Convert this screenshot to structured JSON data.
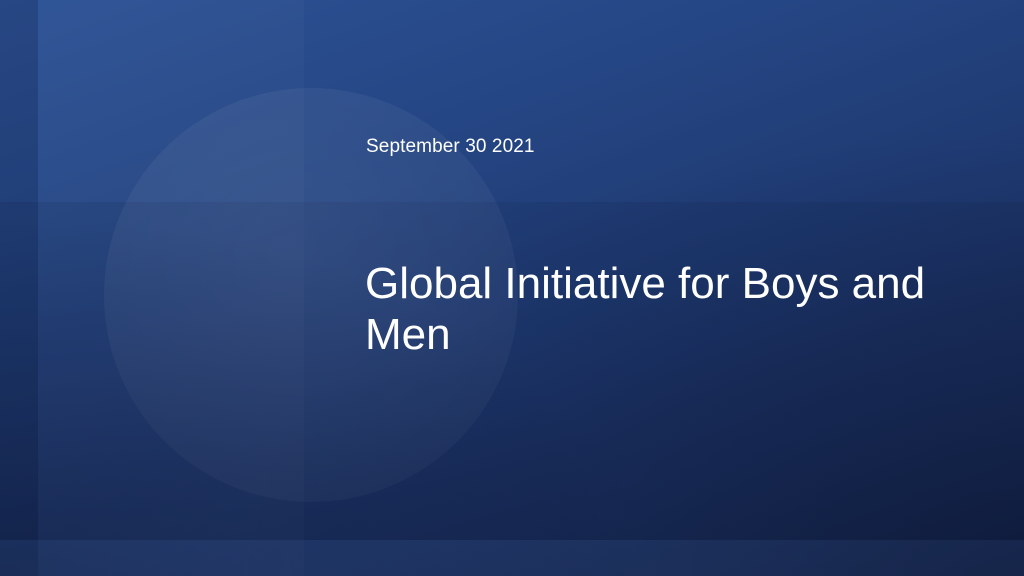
{
  "slide": {
    "date": "September 30 2021",
    "title": "Global Initiative for Boys and Men"
  },
  "colors": {
    "background_top": "#2d5296",
    "background_bottom": "#16264e",
    "text": "#ffffff"
  }
}
